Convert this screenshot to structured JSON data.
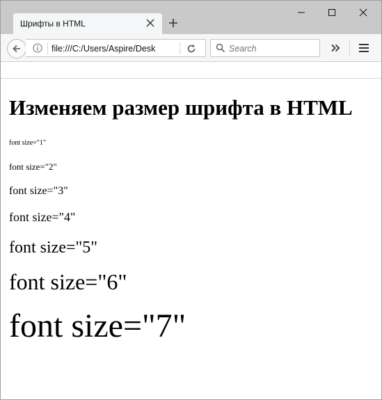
{
  "browser": {
    "tab_title": "Шрифты в HTML",
    "url": "file:///C:/Users/Aspire/Desk",
    "search_placeholder": "Search"
  },
  "page": {
    "heading": "Изменяем размер шрифта в HTML",
    "font_samples": [
      "font size=\"1\"",
      "font size=\"2\"",
      "font size=\"3\"",
      "font size=\"4\"",
      "font size=\"5\"",
      "font size=\"6\"",
      "font size=\"7\""
    ]
  },
  "icons": {
    "tab_close": "close-icon",
    "new_tab": "plus-icon",
    "minimize": "minimize-icon",
    "maximize": "maximize-icon",
    "close": "close-icon",
    "back": "arrow-left-icon",
    "info": "info-icon",
    "reload": "reload-icon",
    "search": "search-icon",
    "overflow": "double-chevron-right-icon",
    "menu": "hamburger-menu-icon"
  },
  "colors": {
    "tabstrip": "#c9c9c9",
    "toolbar": "#f5f6f7",
    "text": "#000000"
  }
}
